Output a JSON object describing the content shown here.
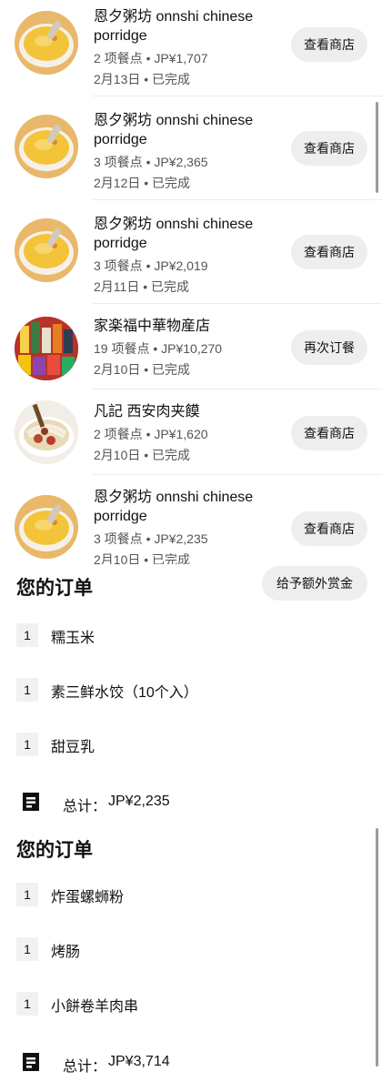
{
  "orders": [
    {
      "store": "恩夕粥坊 onnshi chinese porridge",
      "meta": "2 项餐点 • JP¥1,707",
      "date": "2月13日 • 已完成",
      "action": "查看商店",
      "thumb": "porridge-photo"
    },
    {
      "store": "恩夕粥坊 onnshi chinese porridge",
      "meta": "3 项餐点 • JP¥2,365",
      "date": "2月12日 • 已完成",
      "action": "查看商店",
      "thumb": "porridge-photo"
    },
    {
      "store": "恩夕粥坊 onnshi chinese porridge",
      "meta": "3 项餐点 • JP¥2,019",
      "date": "2月11日 • 已完成",
      "action": "查看商店",
      "thumb": "porridge-photo"
    },
    {
      "store": "家楽福中華物産店",
      "meta": "19 项餐点 • JP¥10,270",
      "date": "2月10日 • 已完成",
      "action": "再次订餐",
      "thumb": "grocery-photo"
    },
    {
      "store": "凡記 西安肉夹饃",
      "meta": "2 项餐点 • JP¥1,620",
      "date": "2月10日 • 已完成",
      "action": "查看商店",
      "thumb": "noodle-photo"
    },
    {
      "store": "恩夕粥坊 onnshi chinese porridge",
      "meta": "3 项餐点 • JP¥2,235",
      "date": "2月10日 • 已完成",
      "action": "查看商店",
      "thumb": "porridge-photo"
    }
  ],
  "receipts": [
    {
      "title": "您的订单",
      "tip_label": "给予额外赏金",
      "items": [
        {
          "qty": "1",
          "name": "糯玉米"
        },
        {
          "qty": "1",
          "name": "素三鲜水饺（10个入）"
        },
        {
          "qty": "1",
          "name": "甜豆乳"
        }
      ],
      "total_label": "总计：",
      "total_value": "JP¥2,235",
      "icon": "receipt-icon"
    },
    {
      "title": "您的订单",
      "items": [
        {
          "qty": "1",
          "name": "炸蛋螺蛳粉"
        },
        {
          "qty": "1",
          "name": "烤肠"
        },
        {
          "qty": "1",
          "name": "小餅卷羊肉串"
        }
      ],
      "total_label": "总计：",
      "total_value": "JP¥3,714",
      "icon": "receipt-icon"
    }
  ],
  "colors": {
    "pill_bg": "#eeeeee",
    "qty_bg": "#f1f1f1",
    "divider": "#ececec",
    "porridge": "#f3c33a"
  }
}
